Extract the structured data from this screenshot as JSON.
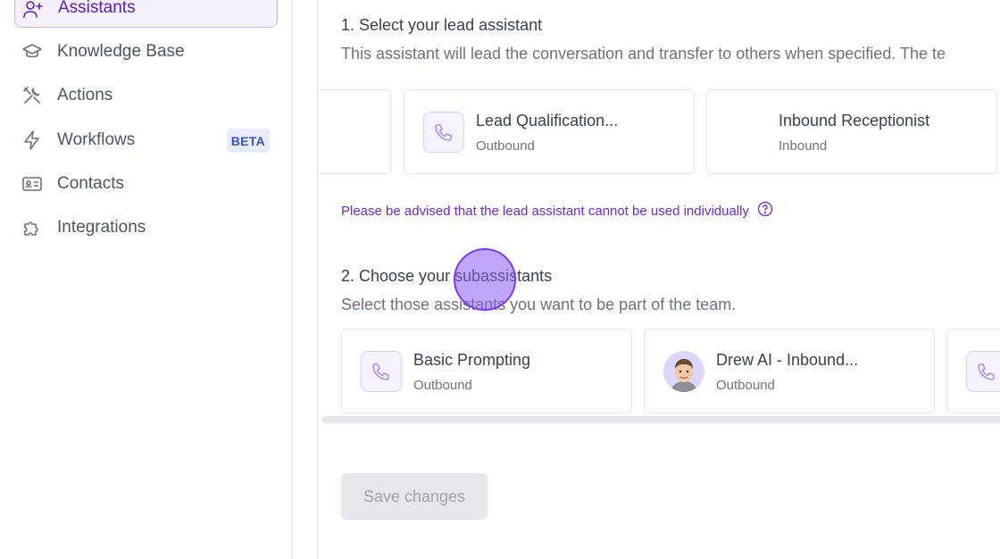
{
  "sidebar": {
    "items": [
      {
        "label": "Assistants",
        "icon": "user-plus-icon",
        "active": true
      },
      {
        "label": "Knowledge Base",
        "icon": "graduation-cap-icon"
      },
      {
        "label": "Actions",
        "icon": "tools-icon"
      },
      {
        "label": "Workflows",
        "icon": "lightning-icon",
        "badge": "BETA"
      },
      {
        "label": "Contacts",
        "icon": "contact-card-icon"
      },
      {
        "label": "Integrations",
        "icon": "puzzle-icon"
      }
    ]
  },
  "main": {
    "section1": {
      "title": "1. Select your lead assistant",
      "description": "This assistant will lead the conversation and transfer to others when specified. The te",
      "cards": [
        {
          "title": "",
          "subtitle": ""
        },
        {
          "title": "Lead Qualification...",
          "subtitle": "Outbound",
          "icon": "phone-icon"
        },
        {
          "title": "Inbound Receptionist",
          "subtitle": "Inbound"
        }
      ],
      "notice": "Please be advised that the lead assistant cannot be used individually"
    },
    "section2": {
      "title": "2. Choose your subassistants",
      "description": "Select those assistants you want to be part of the team.",
      "cards": [
        {
          "title": "Basic Prompting",
          "subtitle": "Outbound",
          "icon": "phone-icon"
        },
        {
          "title": "Drew AI - Inbound...",
          "subtitle": "Outbound",
          "icon": "avatar"
        },
        {
          "title": "",
          "subtitle": "",
          "icon": "phone-icon"
        }
      ]
    },
    "save_label": "Save changes"
  },
  "colors": {
    "accent": "#7c3aed",
    "active_bg": "#f4f0ff",
    "notice": "#6d28d9",
    "beta_bg": "#e8ecfb",
    "beta_text": "#3b54c7"
  }
}
